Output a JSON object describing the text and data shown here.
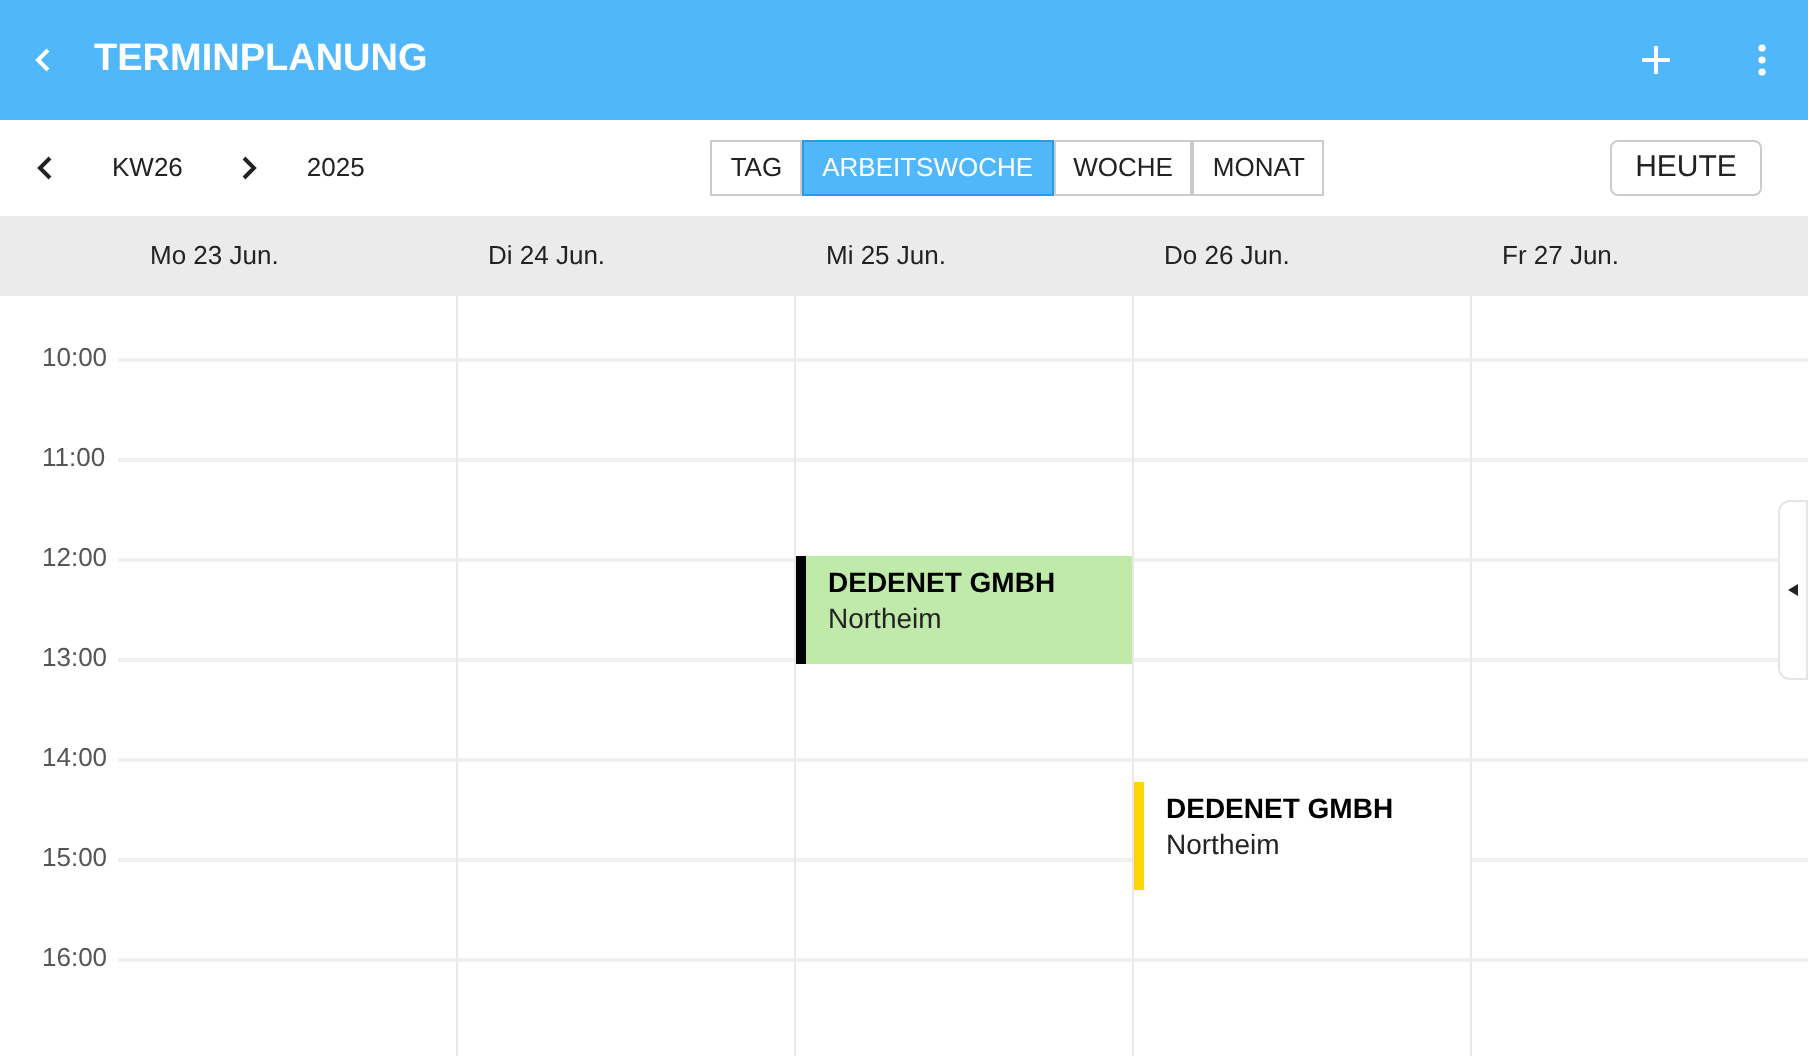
{
  "app_bar": {
    "title": "TERMINPLANUNG"
  },
  "toolbar": {
    "week": "KW26",
    "year": "2025",
    "views": [
      {
        "label": "TAG",
        "selected": false
      },
      {
        "label": "ARBEITSWOCHE",
        "selected": true
      },
      {
        "label": "WOCHE",
        "selected": false
      },
      {
        "label": "MONAT",
        "selected": false
      }
    ],
    "today_button": "HEUTE"
  },
  "days": [
    {
      "label": "Mo 23 Jun."
    },
    {
      "label": "Di 24 Jun."
    },
    {
      "label": "Mi 25 Jun.",
      "events": [
        {
          "title": "DEDENET GMBH",
          "place": "Northeim",
          "kind": "filled",
          "color": "#000000"
        }
      ]
    },
    {
      "label": "Do 26 Jun.",
      "events": [
        {
          "title": "DEDENET GMBH",
          "place": "Northeim",
          "kind": "plain",
          "color": "#ffd600"
        }
      ]
    },
    {
      "label": "Fr 27 Jun."
    }
  ],
  "hours": [
    "10:00",
    "11:00",
    "12:00",
    "13:00",
    "14:00",
    "15:00",
    "16:00"
  ]
}
